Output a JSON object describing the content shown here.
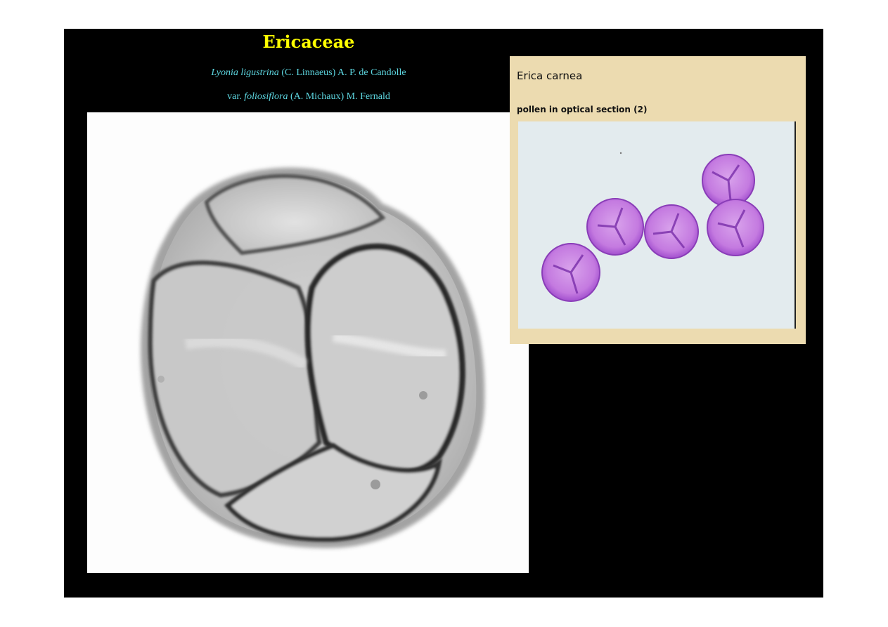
{
  "slide": {
    "title": "Ericaceae",
    "species_line1": {
      "genus_species": "Lyonia ligustrina",
      "authority": " (C. Linnaeus) A. P. de Candolle"
    },
    "species_line2": {
      "prefix": "var. ",
      "variety": "foliosiflora",
      "authority": " (A. Michaux) M. Fernald"
    }
  },
  "inset_panel": {
    "title": "Erica carnea",
    "caption": "pollen in optical section (2)"
  },
  "colors": {
    "slide_background": "#000000",
    "title": "#ffff00",
    "subtitle": "#5dd6e0",
    "panel_background": "#ecdbb0",
    "pollen_stain": "#c77be0"
  }
}
